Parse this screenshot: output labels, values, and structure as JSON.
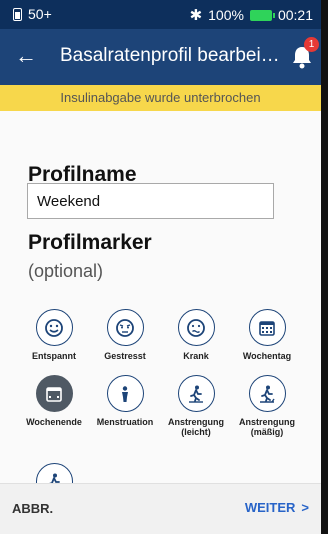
{
  "status": {
    "left": "50+",
    "battery_pct": "100%",
    "time": "00:21"
  },
  "appbar": {
    "title": "Basalratenprofil bearbei…",
    "notification_count": "1"
  },
  "banner": {
    "text": "Insulinabgabe wurde unterbrochen"
  },
  "profile": {
    "heading": "Profilname",
    "name_value": "Weekend"
  },
  "markers": {
    "heading": "Profilmarker",
    "optional": "(optional)",
    "items": [
      {
        "label": "Entspannt",
        "icon": "relaxed-face-icon"
      },
      {
        "label": "Gestresst",
        "icon": "stressed-face-icon"
      },
      {
        "label": "Krank",
        "icon": "sick-face-icon"
      },
      {
        "label": "Wochentag",
        "icon": "calendar-weekday-icon"
      },
      {
        "label": "Wochenende",
        "icon": "calendar-weekend-icon",
        "selected": true
      },
      {
        "label": "Menstruation",
        "icon": "person-icon"
      },
      {
        "label": "Anstrengung (leicht)",
        "icon": "running-light-icon"
      },
      {
        "label": "Anstrengung (mäßig)",
        "icon": "running-moderate-icon"
      },
      {
        "label": "",
        "icon": "running-hard-icon"
      }
    ]
  },
  "footer": {
    "cancel": "ABBR.",
    "next": "WEITER",
    "next_arrow": ">"
  },
  "colors": {
    "statusbar": "#0d2f5c",
    "appbar": "#1d4478",
    "banner": "#f7d74b",
    "accent": "#2864c8",
    "badge": "#e53935"
  }
}
